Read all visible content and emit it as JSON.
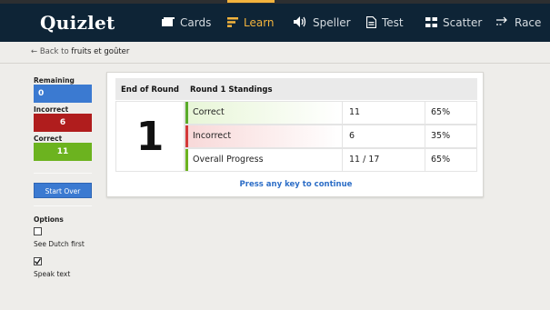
{
  "app": {
    "logo": "Quizlet"
  },
  "nav": [
    {
      "label": "Cards",
      "icon": "cards-icon"
    },
    {
      "label": "Learn",
      "icon": "learn-icon",
      "active": true
    },
    {
      "label": "Speller",
      "icon": "speaker-icon"
    },
    {
      "label": "Test",
      "icon": "test-icon"
    },
    {
      "label": "Scatter",
      "icon": "scatter-icon"
    },
    {
      "label": "Race",
      "icon": "race-icon"
    }
  ],
  "breadcrumb": {
    "prefix": "← Back to",
    "set_name": "fruits et goûter"
  },
  "sidebar": {
    "remaining_label": "Remaining",
    "remaining_value": "0",
    "incorrect_label": "Incorrect",
    "incorrect_value": "6",
    "correct_label": "Correct",
    "correct_value": "11",
    "start_over": "Start Over",
    "options_label": "Options",
    "option1_label": "See Dutch first",
    "option1_checked": false,
    "option2_label": "Speak text",
    "option2_checked": true
  },
  "results": {
    "col1_header": "End of Round",
    "col2_header": "Round 1 Standings",
    "round_number": "1",
    "rows": [
      {
        "label": "Correct",
        "value": "11",
        "percent": "65%"
      },
      {
        "label": "Incorrect",
        "value": "6",
        "percent": "35%"
      },
      {
        "label": "Overall Progress",
        "value": "11 / 17",
        "percent": "65%"
      }
    ],
    "prompt": "Press any key to continue"
  },
  "colors": {
    "nav_bg": "#0e2436",
    "accent": "#f3b33d",
    "blue": "#3b7ad1",
    "red": "#b01d1d",
    "green": "#6cb31f"
  }
}
